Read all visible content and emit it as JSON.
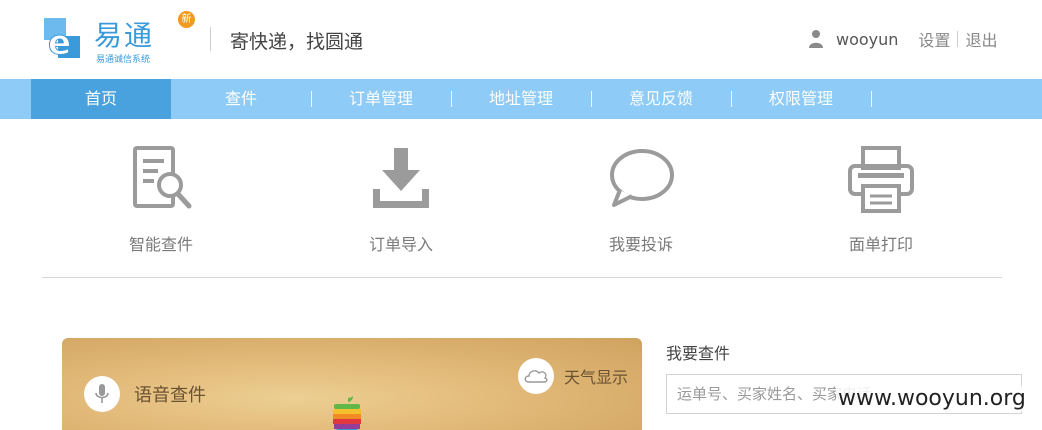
{
  "header": {
    "logo_name": "易通",
    "logo_subtitle": "易通诚信系统",
    "logo_badge": "新",
    "slogan": "寄快递，找圆通",
    "username": "wooyun",
    "settings_label": "设置",
    "logout_label": "退出"
  },
  "nav": {
    "items": [
      {
        "label": "首页",
        "active": true
      },
      {
        "label": "查件"
      },
      {
        "label": "订单管理"
      },
      {
        "label": "地址管理"
      },
      {
        "label": "意见反馈"
      },
      {
        "label": "权限管理"
      }
    ]
  },
  "quick_actions": [
    {
      "label": "智能查件",
      "icon": "document-search-icon"
    },
    {
      "label": "订单导入",
      "icon": "download-icon"
    },
    {
      "label": "我要投诉",
      "icon": "speech-bubble-icon"
    },
    {
      "label": "面单打印",
      "icon": "printer-icon"
    }
  ],
  "banner": {
    "voice_label": "语音查件",
    "weather_label": "天气显示"
  },
  "search": {
    "title": "我要查件",
    "placeholder": "运单号、买家姓名、买家电话"
  },
  "watermark": "www.wooyun.org",
  "colors": {
    "nav_bg": "#8ecbf6",
    "nav_active": "#49a2dd",
    "brand_blue": "#3b9ad9",
    "badge_orange": "#f29a1f",
    "icon_gray": "#9b9b9b"
  }
}
